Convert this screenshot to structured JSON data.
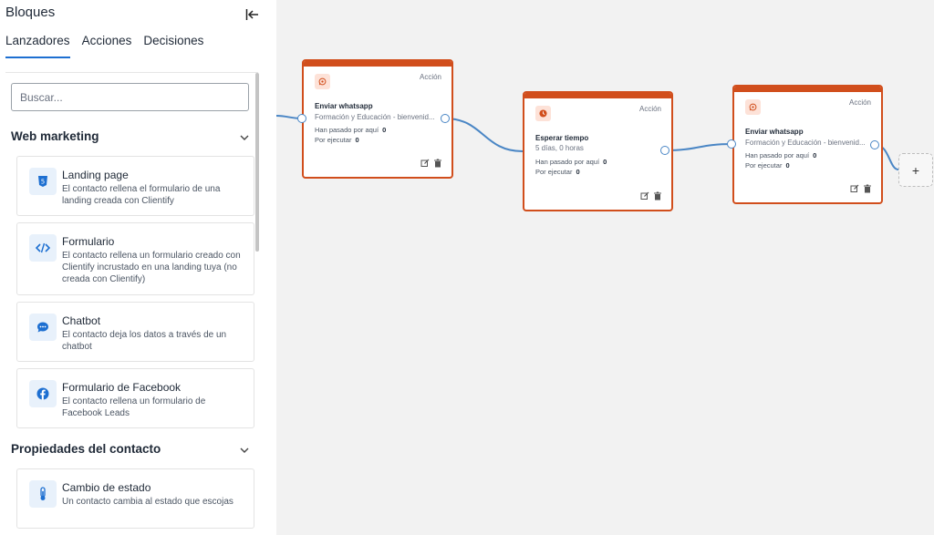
{
  "sidebar": {
    "title": "Bloques",
    "tabs": [
      {
        "label": "Lanzadores",
        "active": true
      },
      {
        "label": "Acciones",
        "active": false
      },
      {
        "label": "Decisiones",
        "active": false
      }
    ],
    "search_placeholder": "Buscar...",
    "sections": [
      {
        "title": "Web marketing",
        "cards": [
          {
            "title": "Landing page",
            "desc": "El contacto rellena el formulario de una landing creada con Clientify",
            "icon": "html5-icon"
          },
          {
            "title": "Formulario",
            "desc": "El contacto rellena un formulario creado con Clientify incrustado en una landing tuya (no creada con Clientify)",
            "icon": "code-icon"
          },
          {
            "title": "Chatbot",
            "desc": "El contacto deja los datos a través de un chatbot",
            "icon": "chat-icon"
          },
          {
            "title": "Formulario de Facebook",
            "desc": "El contacto rellena un formulario de Facebook Leads",
            "icon": "facebook-icon"
          }
        ]
      },
      {
        "title": "Propiedades del contacto",
        "cards": [
          {
            "title": "Cambio de estado",
            "desc": "Un contacto cambia al estado que escojas",
            "icon": "thermometer-icon"
          }
        ]
      }
    ]
  },
  "canvas": {
    "nodes": [
      {
        "type": "Acción",
        "title": "Enviar whatsapp",
        "subtitle": "Formación y Educación - bienvenid...",
        "stat1_label": "Han pasado por aquí",
        "stat1_value": "0",
        "stat2_label": "Por ejecutar",
        "stat2_value": "0",
        "icon": "whatsapp-icon"
      },
      {
        "type": "Acción",
        "title": "Esperar tiempo",
        "subtitle": "5 días, 0 horas",
        "stat1_label": "Han pasado por aquí",
        "stat1_value": "0",
        "stat2_label": "Por ejecutar",
        "stat2_value": "0",
        "icon": "clock-icon"
      },
      {
        "type": "Acción",
        "title": "Enviar whatsapp",
        "subtitle": "Formación y Educación - bienvenid...",
        "stat1_label": "Han pasado por aquí",
        "stat1_value": "0",
        "stat2_label": "Por ejecutar",
        "stat2_value": "0",
        "icon": "whatsapp-icon"
      }
    ],
    "add_label": "+"
  },
  "colors": {
    "accent": "#1d6fd1",
    "node_border": "#d14e1c",
    "wire": "#4a86c5"
  }
}
